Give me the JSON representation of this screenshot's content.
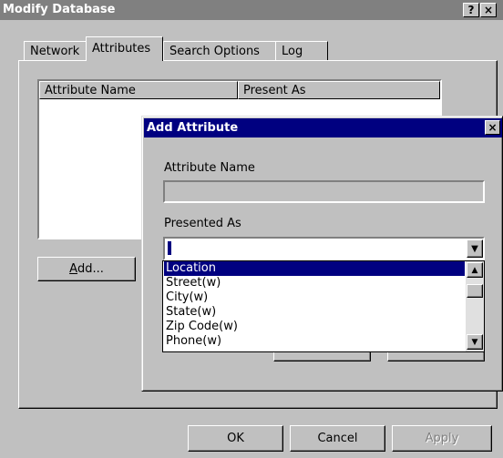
{
  "outer": {
    "title": "Modify Database",
    "help_label": "?",
    "close_label": "×"
  },
  "tabs": [
    {
      "label": "Network"
    },
    {
      "label": "Attributes"
    },
    {
      "label": "Search Options"
    },
    {
      "label": "Log"
    }
  ],
  "list": {
    "columns": [
      "Attribute Name",
      "Present As"
    ]
  },
  "buttons": {
    "add_prefix": "A",
    "add_rest": "dd...",
    "ok": "OK",
    "cancel": "Cancel",
    "apply": "Apply"
  },
  "add_dialog": {
    "title": "Add Attribute",
    "close_label": "×",
    "attr_name_label": "Attribute Name",
    "attr_name_value": "",
    "presented_label": "Presented As",
    "combo_arrow": "▼",
    "options": [
      "Location",
      "Street(w)",
      "City(w)",
      "State(w)",
      "Zip Code(w)",
      "Phone(w)"
    ],
    "selected_option": "Location",
    "scroll_up": "▲",
    "scroll_down": "▼"
  }
}
